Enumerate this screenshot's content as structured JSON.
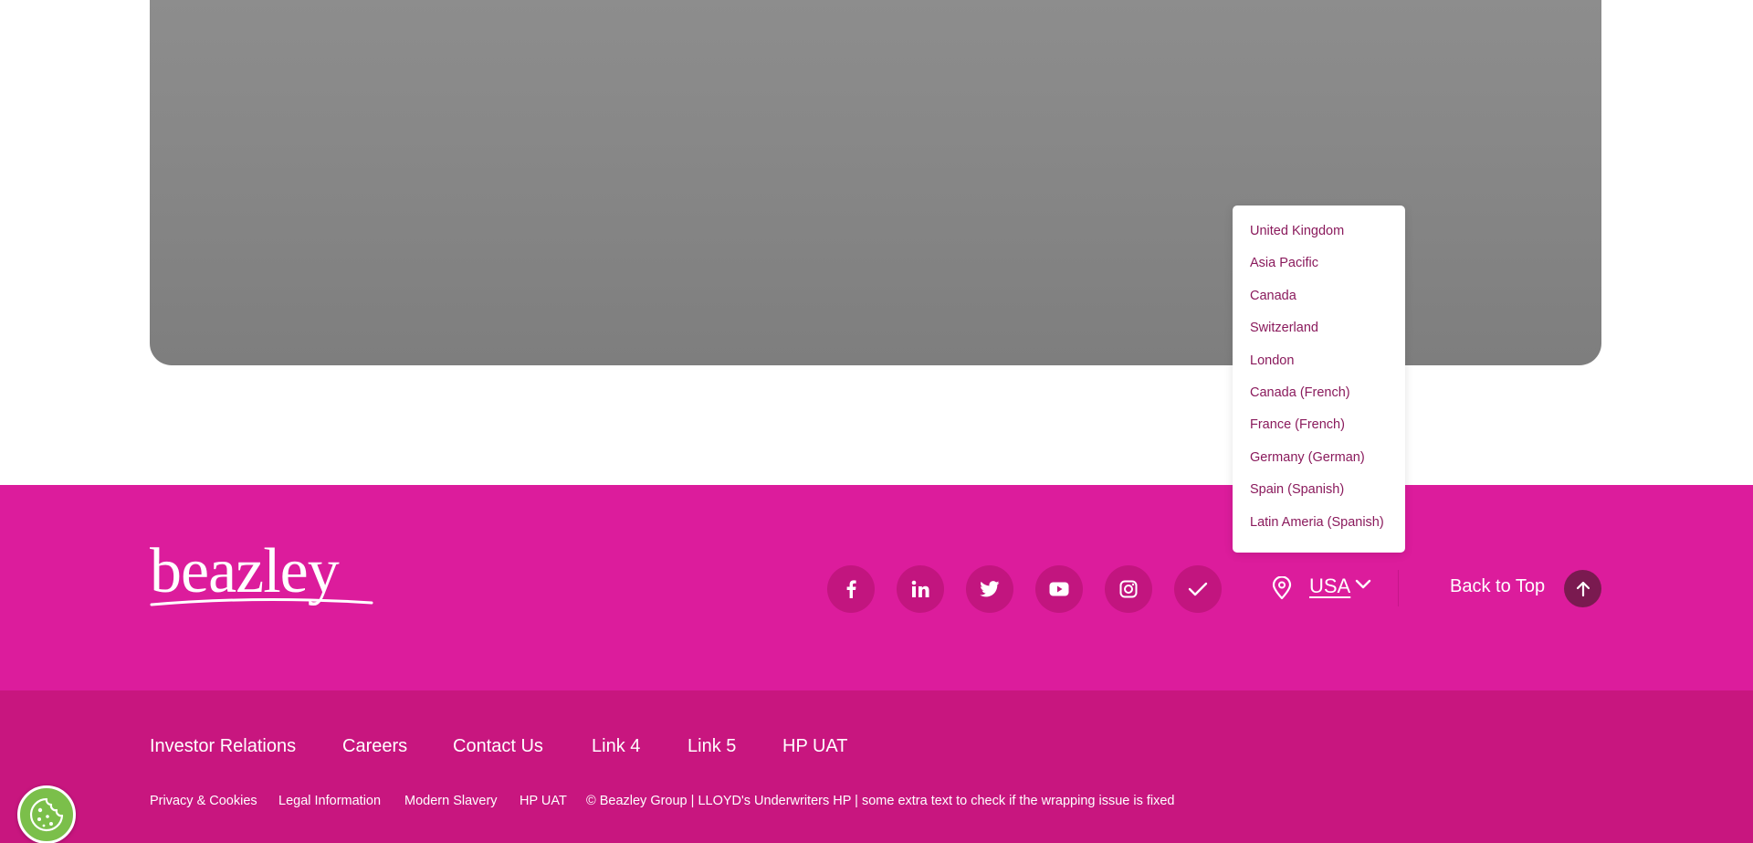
{
  "brand": {
    "logo_text": "beazley"
  },
  "colors": {
    "footer_top": "#dc1c9c",
    "footer_bottom": "#c8167f",
    "social_bg": "#c2157f",
    "back_to_top_bg": "#7a1a50",
    "dropdown_text": "#8a1a5c",
    "cookie_bg": "#7bbf4a"
  },
  "social": [
    {
      "name": "facebook",
      "icon": "facebook-icon"
    },
    {
      "name": "linkedin",
      "icon": "linkedin-icon"
    },
    {
      "name": "twitter",
      "icon": "twitter-icon"
    },
    {
      "name": "youtube",
      "icon": "youtube-icon"
    },
    {
      "name": "instagram",
      "icon": "instagram-icon"
    },
    {
      "name": "check",
      "icon": "checkmark-icon"
    }
  ],
  "region": {
    "selected": "USA",
    "icon": "location-pin-icon",
    "options": [
      "United Kingdom",
      "Asia Pacific",
      "Canada",
      "Switzerland",
      "London",
      "Canada (French)",
      "France (French)",
      "Germany (German)",
      "Spain (Spanish)",
      "Latin Ameria (Spanish)"
    ]
  },
  "back_to_top": {
    "label": "Back to Top"
  },
  "footer_links": [
    "Investor Relations",
    "Careers",
    "Contact Us",
    "Link 4",
    "Link 5",
    "HP UAT"
  ],
  "legal_links": [
    "Privacy & Cookies",
    "Legal Information",
    "Modern Slavery",
    "HP UAT"
  ],
  "copyright": "© Beazley Group | LLOYD's Underwriters HP | some extra text to check if the wrapping issue is fixed",
  "cookie_button": {
    "icon": "cookie-icon"
  }
}
